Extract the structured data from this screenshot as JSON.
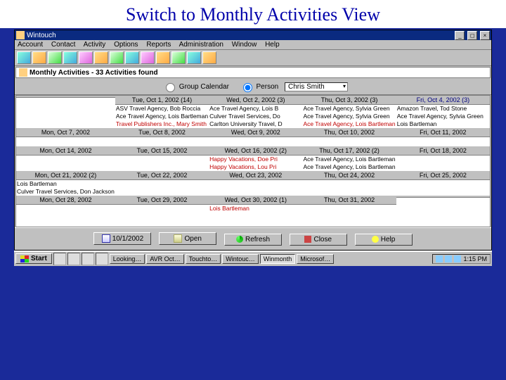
{
  "slide_title": "Switch to Monthly Activities View",
  "window": {
    "title": "Wintouch",
    "subtitle": "Monthly Activities - 33 Activities found"
  },
  "menu": [
    "Account",
    "Contact",
    "Activity",
    "Options",
    "Reports",
    "Administration",
    "Window",
    "Help"
  ],
  "filter": {
    "radio1": "Group Calendar",
    "radio2": "Person",
    "selected": "Chris Smith"
  },
  "buttons": {
    "month": "10/1/2002",
    "open": "Open",
    "refresh": "Refresh",
    "close": "Close",
    "help": "Help"
  },
  "taskbar": {
    "start": "Start",
    "tasks": [
      "Looking…",
      "AVR Oct…",
      "Touchto…",
      "Wintouc…",
      "Winmonth",
      "Microsof…"
    ],
    "active_index": 4,
    "clock": "1:15 PM"
  },
  "weeks": [
    {
      "short": false,
      "days": [
        {
          "header": "",
          "items": []
        },
        {
          "header": "Tue, Oct 1, 2002 (14)",
          "items": [
            {
              "t": "ASV Travel Agency, Bob Roccia"
            },
            {
              "t": "Ace Travel Agency, Lois Bartleman"
            },
            {
              "t": "Travel Publishers Inc., Mary Smith",
              "red": true
            }
          ]
        },
        {
          "header": "Wed, Oct 2, 2002 (3)",
          "items": [
            {
              "t": "Ace Travel Agency, Lois B"
            },
            {
              "t": "Culver Travel Services, Do"
            },
            {
              "t": "Carlton University Travel, D"
            }
          ]
        },
        {
          "header": "Thu, Oct 3, 2002 (3)",
          "items": [
            {
              "t": "Ace Travel Agency, Sylvia Green"
            },
            {
              "t": "Ace Travel Agency, Sylvia Green"
            },
            {
              "t": "Ace Travel Agency, Lois Bartleman",
              "red": true
            }
          ]
        },
        {
          "header": "Fri, Oct 4, 2002 (3)",
          "blue": true,
          "items": [
            {
              "t": "Amazon Travel, Tod Stone"
            },
            {
              "t": "Ace Travel Agency, Sylvia Green"
            },
            {
              "t": "Lois Bartleman"
            }
          ]
        }
      ]
    },
    {
      "short": true,
      "days": [
        {
          "header": "Mon, Oct 7, 2002",
          "items": []
        },
        {
          "header": "Tue, Oct 8, 2002",
          "items": []
        },
        {
          "header": "Wed, Oct 9, 2002",
          "items": []
        },
        {
          "header": "Thu, Oct 10, 2002",
          "items": []
        },
        {
          "header": "Fri, Oct 11, 2002",
          "items": []
        }
      ]
    },
    {
      "short": true,
      "days": [
        {
          "header": "Mon, Oct 14, 2002",
          "items": []
        },
        {
          "header": "Tue, Oct 15, 2002",
          "items": []
        },
        {
          "header": "Wed, Oct 16, 2002 (2)",
          "items": [
            {
              "t": "Happy Vacations, Doe Pri",
              "red": true
            },
            {
              "t": "Happy Vacations, Lou Pri",
              "red": true
            }
          ]
        },
        {
          "header": "Thu, Oct 17, 2002 (2)",
          "items": [
            {
              "t": "Ace Travel Agency, Lois Bartleman"
            },
            {
              "t": "Ace Travel Agency, Lois Bartleman"
            }
          ]
        },
        {
          "header": "Fri, Oct 18, 2002",
          "items": []
        }
      ]
    },
    {
      "short": true,
      "days": [
        {
          "header": "Mon, Oct 21, 2002 (2)",
          "items": [
            {
              "t": "Lois Bartleman"
            },
            {
              "t": "Culver Travel Services, Don Jackson"
            }
          ]
        },
        {
          "header": "Tue, Oct 22, 2002",
          "items": []
        },
        {
          "header": "Wed, Oct 23, 2002",
          "items": []
        },
        {
          "header": "Thu, Oct 24, 2002",
          "items": []
        },
        {
          "header": "Fri, Oct 25, 2002",
          "items": []
        }
      ]
    },
    {
      "short": false,
      "days": [
        {
          "header": "Mon, Oct 28, 2002",
          "items": []
        },
        {
          "header": "Tue, Oct 29, 2002",
          "items": []
        },
        {
          "header": "Wed, Oct 30, 2002 (1)",
          "items": [
            {
              "t": "Lois Bartleman",
              "red": true
            }
          ]
        },
        {
          "header": "Thu, Oct 31, 2002",
          "items": []
        },
        {
          "header": "",
          "items": []
        }
      ]
    }
  ]
}
